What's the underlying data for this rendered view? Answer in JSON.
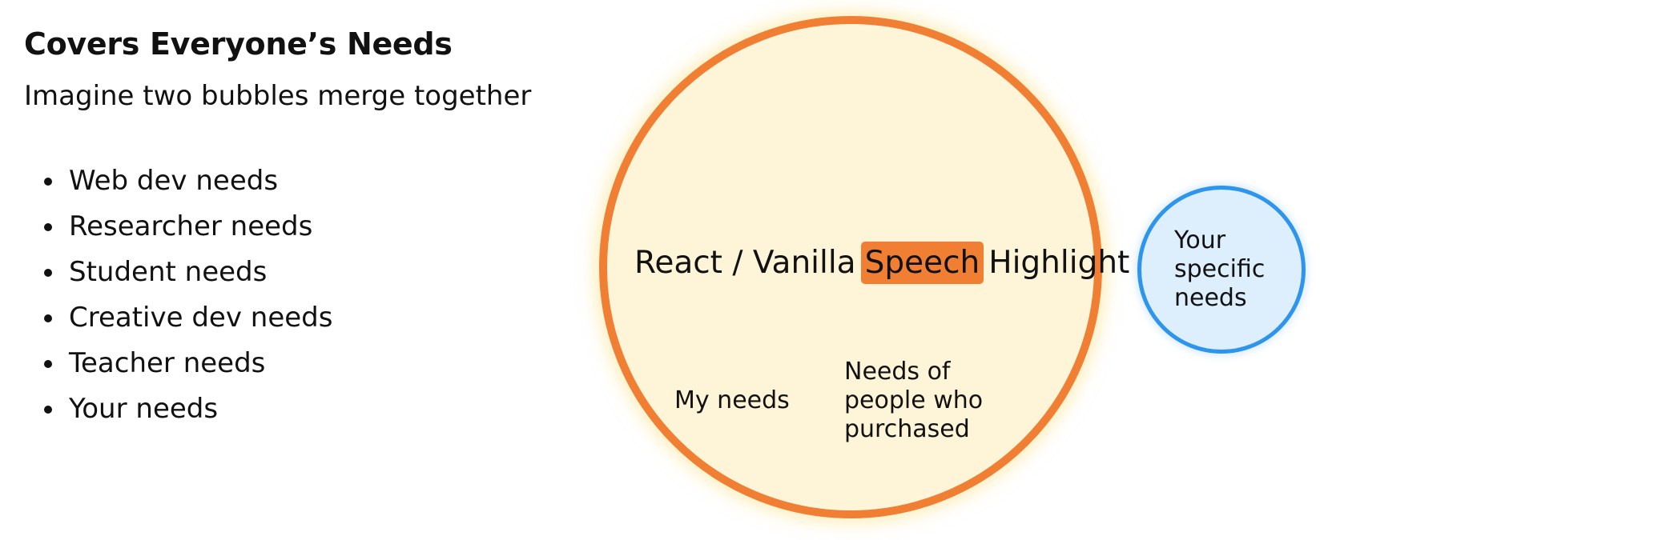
{
  "header": {
    "title": "Covers Everyone’s Needs",
    "subtitle": "Imagine two bubbles merge together"
  },
  "needs": [
    "Web dev needs",
    "Researcher needs",
    "Student needs",
    "Creative dev needs",
    "Teacher needs",
    "Your needs"
  ],
  "big_bubble": {
    "headline_prefix": "React / Vanilla",
    "headline_highlight": "Speech",
    "headline_suffix": "Highlight",
    "left_label": "My needs",
    "right_label_lines": [
      "Needs of",
      "people who",
      "purchased"
    ]
  },
  "small_bubble": {
    "label_lines": [
      "Your",
      "specific",
      "needs"
    ]
  },
  "colors": {
    "orange": "#F07F34",
    "big_fill": "#FEF5D8",
    "blue": "#2E95EC",
    "small_fill": "#DDEEFD"
  }
}
